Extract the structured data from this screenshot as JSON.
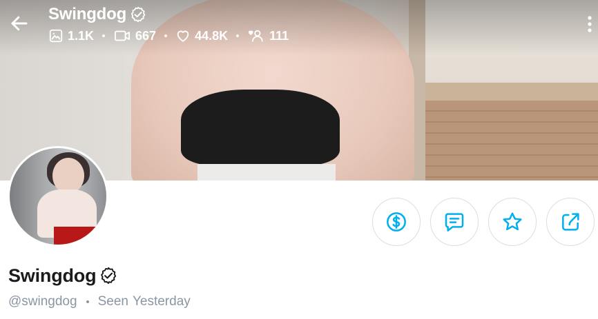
{
  "header": {
    "title": "Swingdog",
    "back_icon": "arrow-left-icon",
    "verified_icon": "verified-badge-icon",
    "more_icon": "more-vertical-icon",
    "stats": [
      {
        "icon": "image-icon",
        "value": "1.1K"
      },
      {
        "icon": "video-icon",
        "value": "667"
      },
      {
        "icon": "heart-icon",
        "value": "44.8K"
      },
      {
        "icon": "fans-icon",
        "value": "111"
      }
    ]
  },
  "profile": {
    "name": "Swingdog",
    "handle": "@swingdog",
    "seen_label": "Seen",
    "seen_value": "Yesterday"
  },
  "actions": [
    {
      "name": "tip",
      "icon": "dollar-icon"
    },
    {
      "name": "message",
      "icon": "message-icon"
    },
    {
      "name": "favorite",
      "icon": "star-icon"
    },
    {
      "name": "share",
      "icon": "share-icon"
    }
  ],
  "colors": {
    "accent": "#00aff0",
    "text_primary": "#1b1b1b",
    "text_secondary": "#8a96a3",
    "button_border": "#dcdde0"
  }
}
